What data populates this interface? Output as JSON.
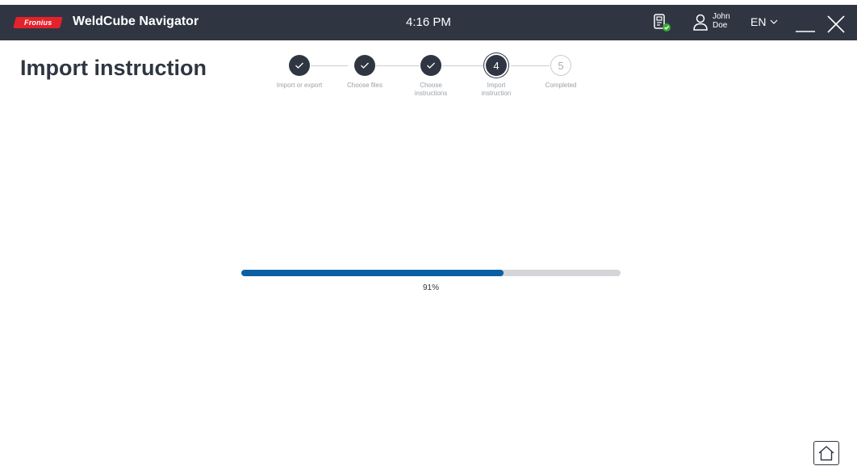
{
  "header": {
    "logo_text": "Fronius",
    "app_title": "WeldCube Navigator",
    "time": "4:16 PM",
    "user": {
      "first_name": "John",
      "last_name": "Doe"
    },
    "language": "EN",
    "icons": [
      "device-status-icon",
      "user-icon",
      "chevron-down-icon",
      "minimize-icon",
      "close-icon"
    ]
  },
  "page": {
    "title": "Import instruction"
  },
  "stepper": {
    "current_step": 4,
    "steps": [
      {
        "number": "1",
        "label_lines": [
          "Import or export",
          ""
        ],
        "status": "done"
      },
      {
        "number": "2",
        "label_lines": [
          "Choose files",
          ""
        ],
        "status": "done"
      },
      {
        "number": "3",
        "label_lines": [
          "Choose",
          "instructions"
        ],
        "status": "done"
      },
      {
        "number": "4",
        "label_lines": [
          "Import",
          "instruction"
        ],
        "status": "active"
      },
      {
        "number": "5",
        "label_lines": [
          "Completed",
          ""
        ],
        "status": "pending"
      }
    ]
  },
  "progress": {
    "percent": 91,
    "label": "91%"
  },
  "footer": {
    "home_icon": "home-icon"
  },
  "colors": {
    "header_bg": "#2f3642",
    "brand_red": "#e4222b",
    "progress_fill": "#0b5fa5",
    "progress_track": "#d3d5d9",
    "status_ok": "#3aaa35"
  }
}
